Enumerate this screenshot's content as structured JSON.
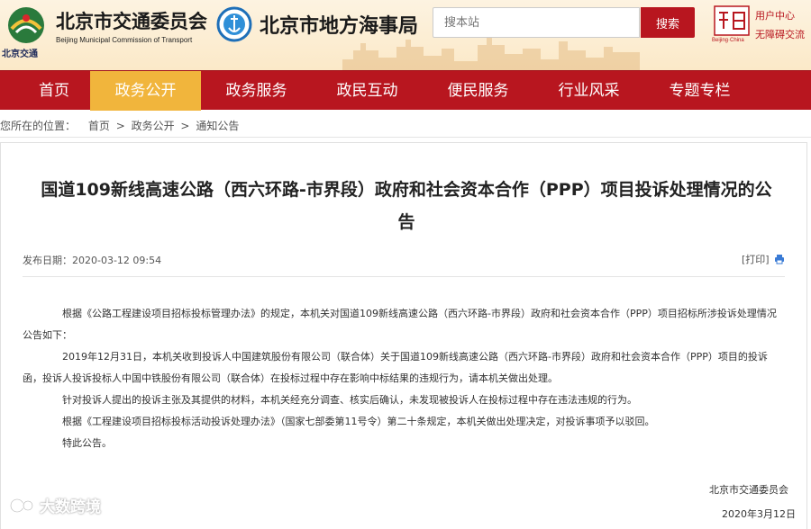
{
  "header": {
    "logo1_caption": "北京交通",
    "agency_name": "北京市交通委员会",
    "agency_name_en": "Beijing Municipal Commission of Transport",
    "maritime_name": "北京市地方海事局",
    "search_placeholder": "搜本站",
    "search_button": "搜索",
    "logo3_sub": "Beijing·China",
    "user_center": "用户中心",
    "accessibility": "无障碍交流"
  },
  "nav": {
    "items": [
      "首页",
      "政务公开",
      "政务服务",
      "政民互动",
      "便民服务",
      "行业风采",
      "专题专栏"
    ],
    "active_index": 1
  },
  "breadcrumb": {
    "prefix": "您所在的位置：",
    "items": [
      "首页",
      "政务公开",
      "通知公告"
    ],
    "separator": ">"
  },
  "article": {
    "title": "国道109新线高速公路（西六环路-市界段）政府和社会资本合作（PPP）项目投诉处理情况的公告",
    "publish_date": "发布日期：2020-03-12 09:54",
    "print_label": "[打印]",
    "paragraphs": [
      "根据《公路工程建设项目招标投标管理办法》的规定，本机关对国道109新线高速公路（西六环路-市界段）政府和社会资本合作（PPP）项目招标所涉投诉处理情况公告如下：",
      "2019年12月31日，本机关收到投诉人中国建筑股份有限公司（联合体）关于国道109新线高速公路（西六环路-市界段）政府和社会资本合作（PPP）项目的投诉函，投诉人投诉投标人中国中铁股份有限公司（联合体）在投标过程中存在影响中标结果的违规行为，请本机关做出处理。",
      "针对投诉人提出的投诉主张及其提供的材料，本机关经充分调查、核实后确认，未发现被投诉人在投标过程中存在违法违规的行为。",
      "根据《工程建设项目招标投标活动投诉处理办法》（国家七部委第11号令）第二十条规定，本机关做出处理决定，对投诉事项予以驳回。",
      "特此公告。"
    ],
    "signature_org": "北京市交通委员会",
    "signature_date": "2020年3月12日"
  },
  "watermark": "大数跨境",
  "colors": {
    "nav_red": "#b8161f",
    "nav_active": "#f1b53c",
    "header_bg": "#fbe9c8"
  }
}
